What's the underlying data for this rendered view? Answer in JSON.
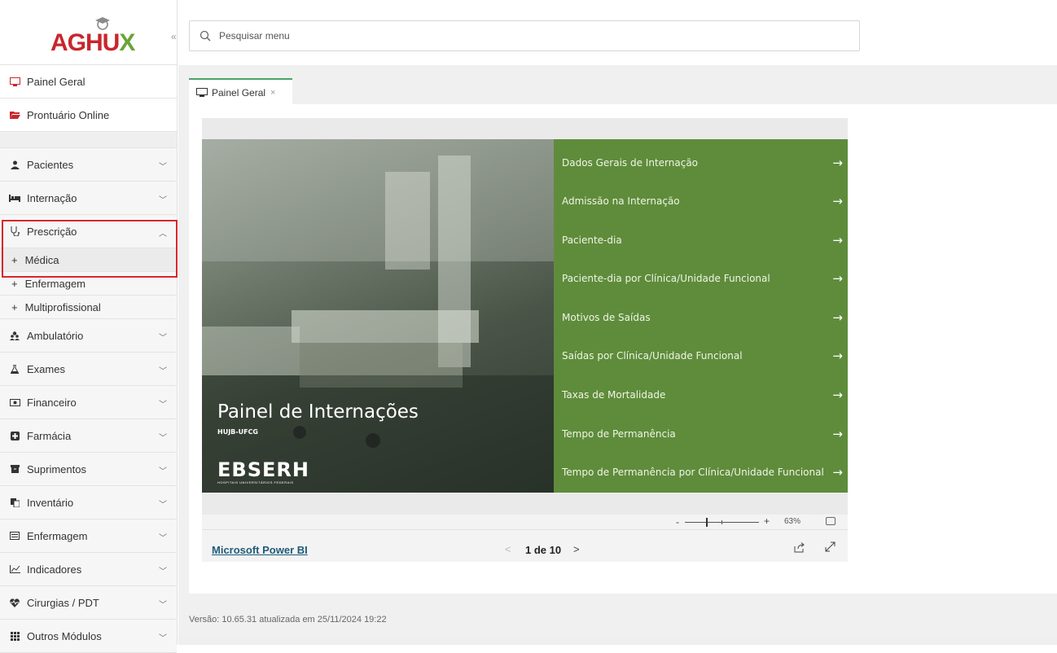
{
  "logo": {
    "text_a": "AGH",
    "text_u": "U",
    "text_x": "X"
  },
  "collapse": "«",
  "search": {
    "placeholder": "Pesquisar menu"
  },
  "sidebar": {
    "top_items": [
      {
        "label": "Painel Geral",
        "icon": "monitor-icon"
      },
      {
        "label": "Prontuário Online",
        "icon": "folder-open-icon"
      }
    ],
    "items": [
      {
        "label": "Pacientes",
        "icon": "user-icon"
      },
      {
        "label": "Internação",
        "icon": "bed-icon"
      },
      {
        "label": "Prescrição",
        "icon": "stethoscope-icon"
      },
      {
        "label": "Ambulatório",
        "icon": "users-icon"
      },
      {
        "label": "Exames",
        "icon": "flask-icon"
      },
      {
        "label": "Financeiro",
        "icon": "money-icon"
      },
      {
        "label": "Farmácia",
        "icon": "plus-square-icon"
      },
      {
        "label": "Suprimentos",
        "icon": "archive-icon"
      },
      {
        "label": "Inventário",
        "icon": "copy-icon"
      },
      {
        "label": "Enfermagem",
        "icon": "list-alt-icon"
      },
      {
        "label": "Indicadores",
        "icon": "line-chart-icon"
      },
      {
        "label": "Cirurgias / PDT",
        "icon": "heartbeat-icon"
      },
      {
        "label": "Outros Módulos",
        "icon": "grid-icon"
      }
    ],
    "prescricao_subitems": [
      "Médica",
      "Enfermagem",
      "Multiprofissional"
    ]
  },
  "tab": {
    "label": "Painel Geral",
    "close": "×"
  },
  "powerbi": {
    "title": "Painel de Internações",
    "subtitle": "HUJB-UFCG",
    "brand": "EBSERH",
    "brand_sub": "HOSPITAIS UNIVERSITÁRIOS FEDERAIS",
    "links": [
      "Dados Gerais de Internação",
      "Admissão na Internação",
      "Paciente-dia",
      "Paciente-dia por Clínica/Unidade Funcional",
      "Motivos de Saídas",
      "Saídas por Clínica/Unidade Funcional",
      "Taxas de Mortalidade",
      "Tempo de Permanência",
      "Tempo de Permanência por Clínica/Unidade Funcional"
    ],
    "zoom": {
      "minus": "-",
      "plus": "+",
      "value": "63%"
    },
    "footer_link": "Microsoft Power BI",
    "pagination": "1 de 10"
  },
  "version": "Versão: 10.65.31 atualizada em 25/11/2024 19:22",
  "colors": {
    "brand_red": "#c8262d",
    "brand_green": "#6aa337",
    "panel_green": "#5f8c3b",
    "highlight": "#d9262c"
  }
}
